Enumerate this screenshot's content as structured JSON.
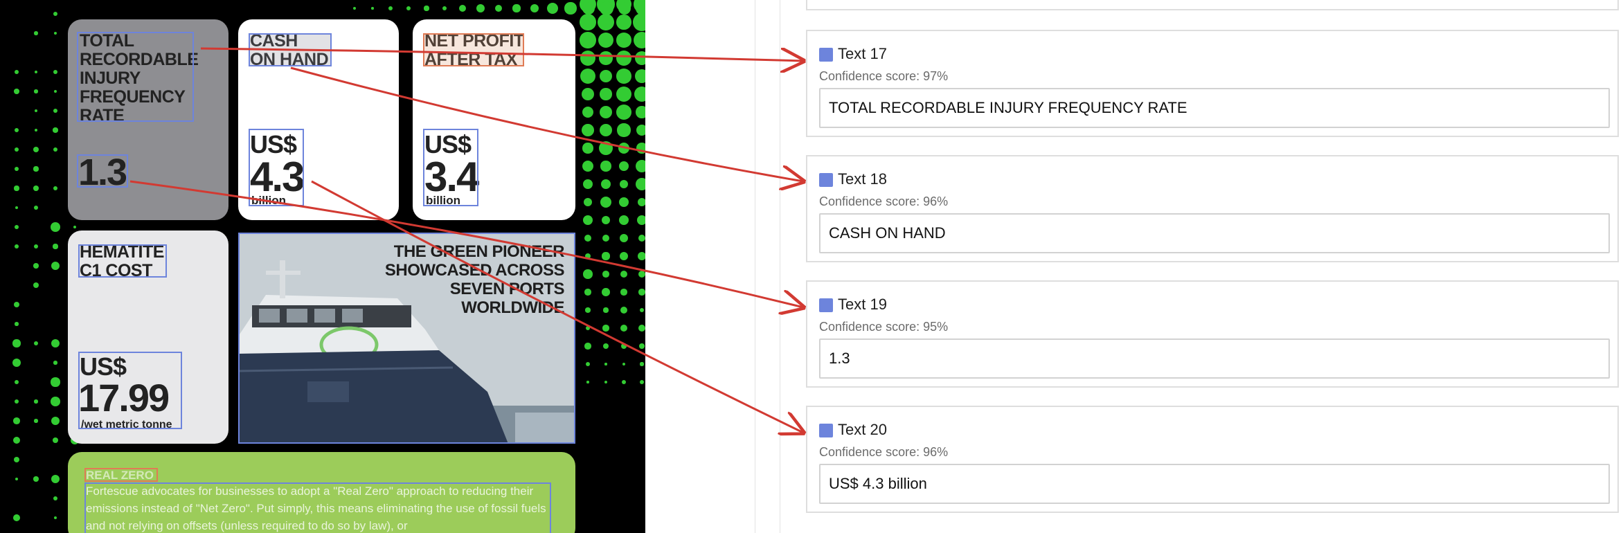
{
  "document": {
    "cards": {
      "trifr": {
        "title": "TOTAL\nRECORDABLE\nINJURY\nFREQUENCY\nRATE",
        "value": "1.3"
      },
      "cash": {
        "title": "CASH\nON HAND",
        "currency": "US$",
        "value": "4.3",
        "unit": "billion"
      },
      "npat": {
        "title": "NET PROFIT\nAFTER TAX",
        "currency": "US$",
        "value": "3.4",
        "unit": "billion"
      },
      "hematite": {
        "title": "HEMATITE\nC1 COST",
        "currency": "US$",
        "value": "17.99",
        "unit": "/wet metric tonne"
      },
      "ship": {
        "headline": "THE GREEN PIONEER\nSHOWCASED ACROSS\nSEVEN PORTS\nWORLDWIDE"
      },
      "realzero": {
        "title": "REAL ZERO",
        "body": "Fortescue advocates for businesses to adopt a \"Real Zero\" approach to reducing their emissions instead of \"Net Zero\". Put simply, this means eliminating the use of fossil fuels and not relying on offsets (unless required to do so by law), or"
      }
    }
  },
  "results": [
    {
      "name": "Text 17",
      "confidence": "Confidence score: 97%",
      "text": "TOTAL RECORDABLE INJURY FREQUENCY RATE"
    },
    {
      "name": "Text 18",
      "confidence": "Confidence score: 96%",
      "text": "CASH ON HAND"
    },
    {
      "name": "Text 19",
      "confidence": "Confidence score: 95%",
      "text": "1.3"
    },
    {
      "name": "Text 20",
      "confidence": "Confidence score: 96%",
      "text": "US$ 4.3 billion"
    }
  ],
  "colors": {
    "document_background": "#000000",
    "dots": "#33cc33",
    "box_outline": "#6d84dc",
    "box_outline_alt": "#e07b55",
    "arrow": "#d23a32",
    "card_grey": "#8e8e92",
    "card_white": "#ffffff",
    "card_light": "#e8e8ea",
    "realzero_green": "#9ccc5a"
  },
  "icons": {
    "result_swatch": "blue-square-icon"
  }
}
